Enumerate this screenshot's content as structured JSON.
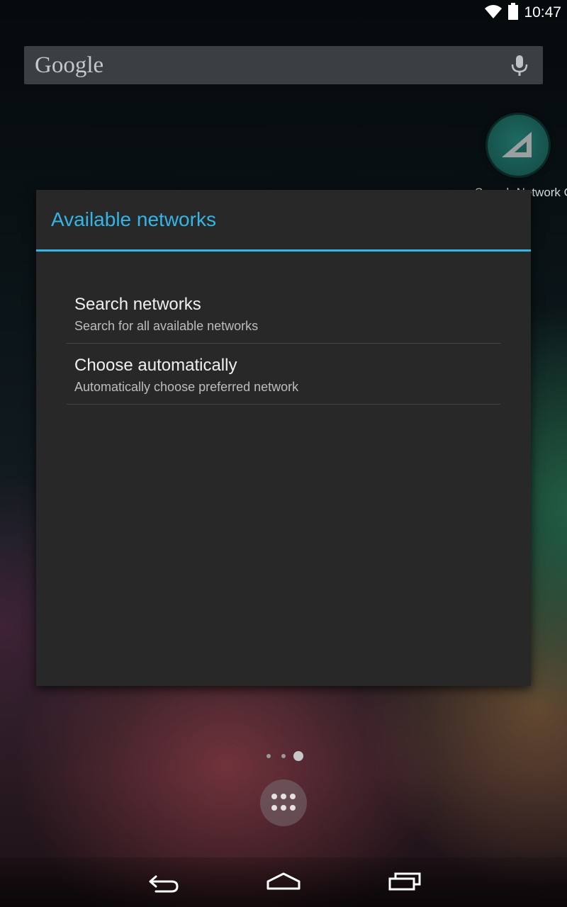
{
  "status_bar": {
    "time": "10:47",
    "icons": [
      "wifi-icon",
      "battery-icon"
    ]
  },
  "search_bar": {
    "logo_text": "Google",
    "icon": "mic-icon"
  },
  "home_icon": {
    "label": "Search Network O",
    "icon": "signal-triangle-icon",
    "accent": "#1e6b63"
  },
  "dialog": {
    "title": "Available networks",
    "accent": "#33b5e5",
    "items": [
      {
        "title": "Search networks",
        "summary": "Search for all available networks"
      },
      {
        "title": "Choose automatically",
        "summary": "Automatically choose preferred network"
      }
    ]
  },
  "page_indicator": {
    "pages": 3,
    "current": 3
  },
  "nav_bar": {
    "buttons": [
      "back-icon",
      "home-icon",
      "recents-icon"
    ]
  }
}
